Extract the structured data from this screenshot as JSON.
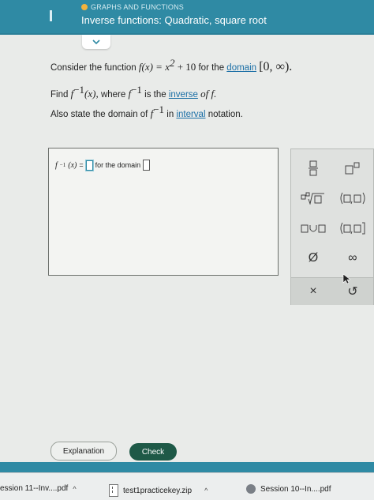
{
  "header": {
    "module": "GRAPHS AND FUNCTIONS",
    "title": "Inverse functions: Quadratic, square root"
  },
  "question": {
    "line1_prefix": "Consider the function",
    "fx": "f(x) = x",
    "exp2": "2",
    "fx_tail": "+ 10",
    "for_the": "for the",
    "domain_link": "domain",
    "interval": "[0, ∞).",
    "line2_prefix": "Find",
    "finv": "f",
    "minus_one": "−1",
    "x_arg": "(x),",
    "where": "where",
    "is_the": "is the",
    "inverse_link": "inverse",
    "of_f": "of f.",
    "line3_prefix": "Also state the domain of",
    "in_text": "in",
    "interval_link": "interval",
    "notation": "notation."
  },
  "answer": {
    "lhs": "f",
    "minus_one": "−1",
    "x": "(x)",
    "equals": "=",
    "for_domain": "for the domain"
  },
  "palette": {
    "fraction": "▭/▭",
    "power": "▭▫",
    "root": "▫√▭",
    "open_interval": "(▭,▭)",
    "union": "▭∪▭",
    "half_open": "(▭,▭]",
    "empty_set": "Ø",
    "infinity": "∞",
    "clear": "×",
    "undo": "↺"
  },
  "buttons": {
    "explanation": "Explanation",
    "check": "Check"
  },
  "downloads": {
    "item1": "ession 11--Inv....pdf",
    "item2": "test1practicekey.zip",
    "item3": "Session 10--In....pdf"
  }
}
